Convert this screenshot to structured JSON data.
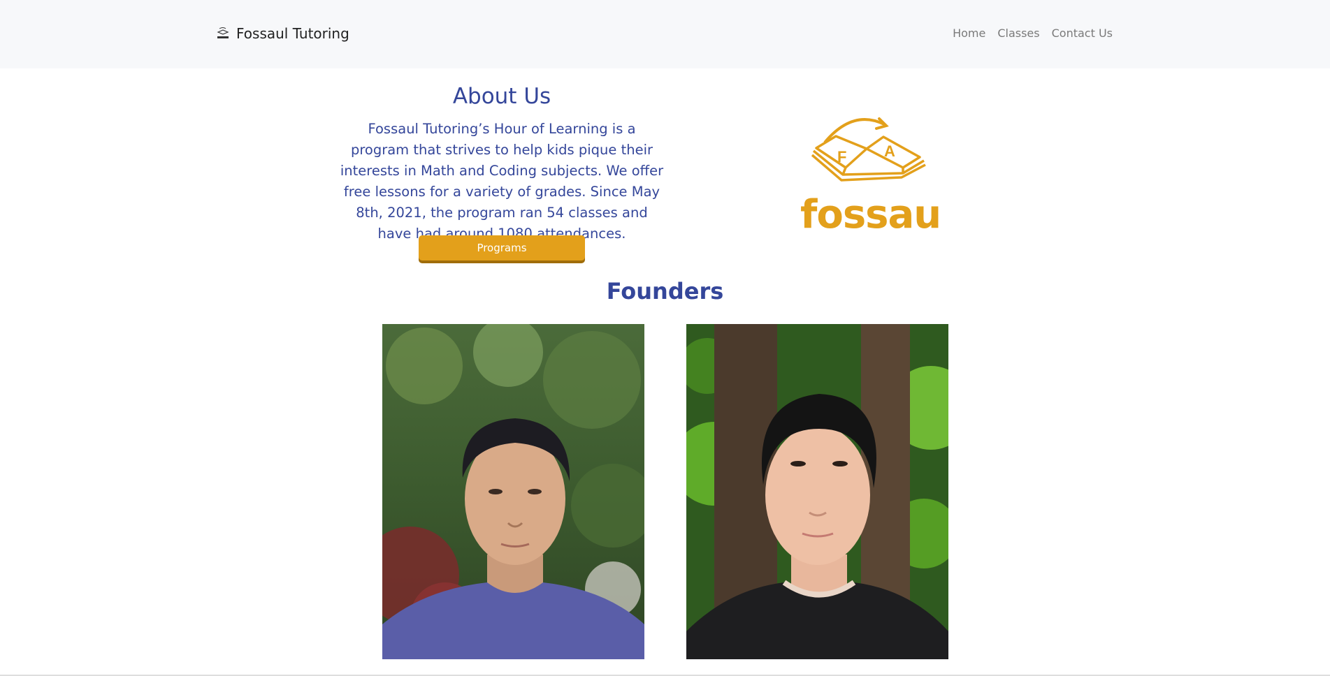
{
  "brand": {
    "name": "Fossaul Tutoring",
    "logo_text": "fossaul"
  },
  "nav": {
    "items": [
      {
        "label": "Home"
      },
      {
        "label": "Classes"
      },
      {
        "label": "Contact Us"
      }
    ]
  },
  "about": {
    "title": "About Us",
    "text": "Fossaul Tutoring’s Hour of Learning is a program that strives to help kids pique their interests in Math and Coding subjects. We offer free lessons for a variety of grades. Since May 8th, 2021, the program ran 54 classes and have had around 1080 attendances.",
    "button_label": "Programs"
  },
  "hero_logo": {
    "book_letters": [
      "F",
      "A"
    ],
    "wordmark": "fossaul"
  },
  "founders": {
    "title": "Founders"
  },
  "colors": {
    "heading": "#34469a",
    "accent": "#e3a01b",
    "navbar_bg": "#f7f8fa"
  }
}
